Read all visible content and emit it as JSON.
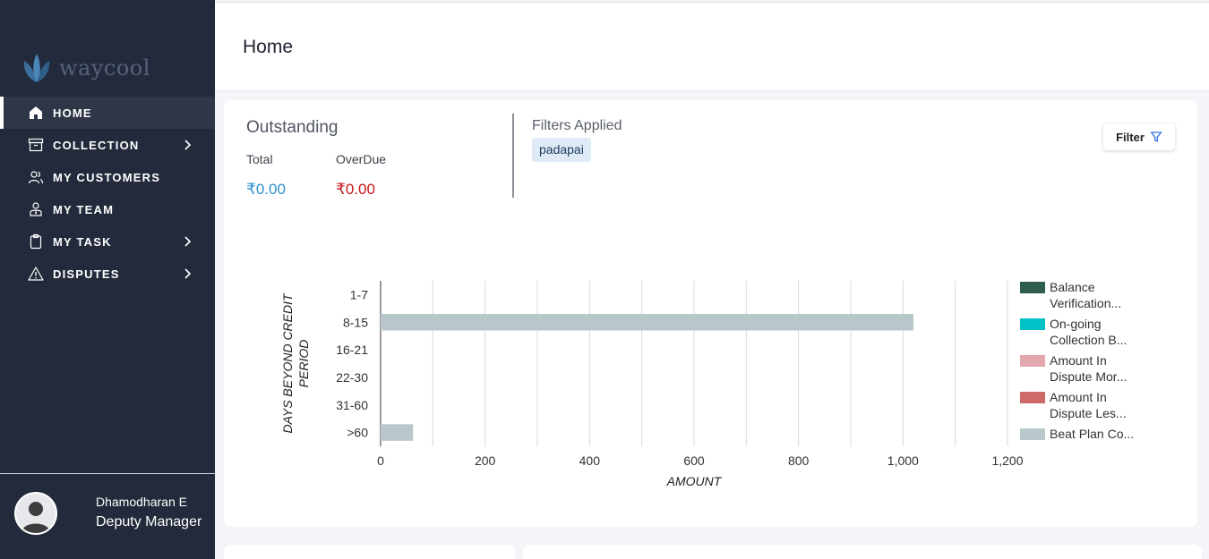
{
  "brand": {
    "name": "waycool"
  },
  "sidebar": {
    "items": [
      {
        "label": "HOME",
        "icon": "home-icon",
        "active": true,
        "has_submenu": false
      },
      {
        "label": "COLLECTION",
        "icon": "archive-icon",
        "active": false,
        "has_submenu": true
      },
      {
        "label": "MY CUSTOMERS",
        "icon": "users-icon",
        "active": false,
        "has_submenu": false
      },
      {
        "label": "MY TEAM",
        "icon": "team-icon",
        "active": false,
        "has_submenu": false
      },
      {
        "label": "MY TASK",
        "icon": "clipboard-icon",
        "active": false,
        "has_submenu": true
      },
      {
        "label": "DISPUTES",
        "icon": "warning-icon",
        "active": false,
        "has_submenu": true
      }
    ]
  },
  "user": {
    "name": "Dhamodharan E",
    "role": "Deputy Manager"
  },
  "header": {
    "title": "Home"
  },
  "outstanding": {
    "title": "Outstanding",
    "total_label": "Total",
    "total_value": "₹0.00",
    "overdue_label": "OverDue",
    "overdue_value": "₹0.00"
  },
  "filters": {
    "title": "Filters Applied",
    "applied": [
      "padapai"
    ],
    "button_label": "Filter"
  },
  "chart_data": {
    "type": "bar",
    "orientation": "horizontal",
    "stacked": true,
    "categories": [
      "1-7",
      "8-15",
      "16-21",
      "22-30",
      "31-60",
      ">60"
    ],
    "xlabel": "AMOUNT",
    "ylabel": "DAYS BEYOND CREDIT PERIOD",
    "xlim": [
      0,
      1200
    ],
    "xticks": [
      "0",
      "200",
      "400",
      "600",
      "800",
      "1,000",
      "1,200"
    ],
    "grid": true,
    "legend_position": "right",
    "series": [
      {
        "name": "Balance Verification...",
        "color": "#2f5d50",
        "values": [
          0,
          0,
          0,
          0,
          0,
          0
        ]
      },
      {
        "name": "On-going Collection B...",
        "color": "#00c2c7",
        "values": [
          0,
          0,
          0,
          0,
          0,
          0
        ]
      },
      {
        "name": "Amount In Dispute Mor...",
        "color": "#e3a7ae",
        "values": [
          0,
          0,
          0,
          0,
          0,
          0
        ]
      },
      {
        "name": "Amount In Dispute Les...",
        "color": "#cf6a6a",
        "values": [
          0,
          0,
          0,
          0,
          0,
          0
        ]
      },
      {
        "name": "Beat Plan Co...",
        "color": "#b8c7c9",
        "values": [
          0,
          1020,
          0,
          0,
          0,
          62
        ]
      }
    ]
  }
}
